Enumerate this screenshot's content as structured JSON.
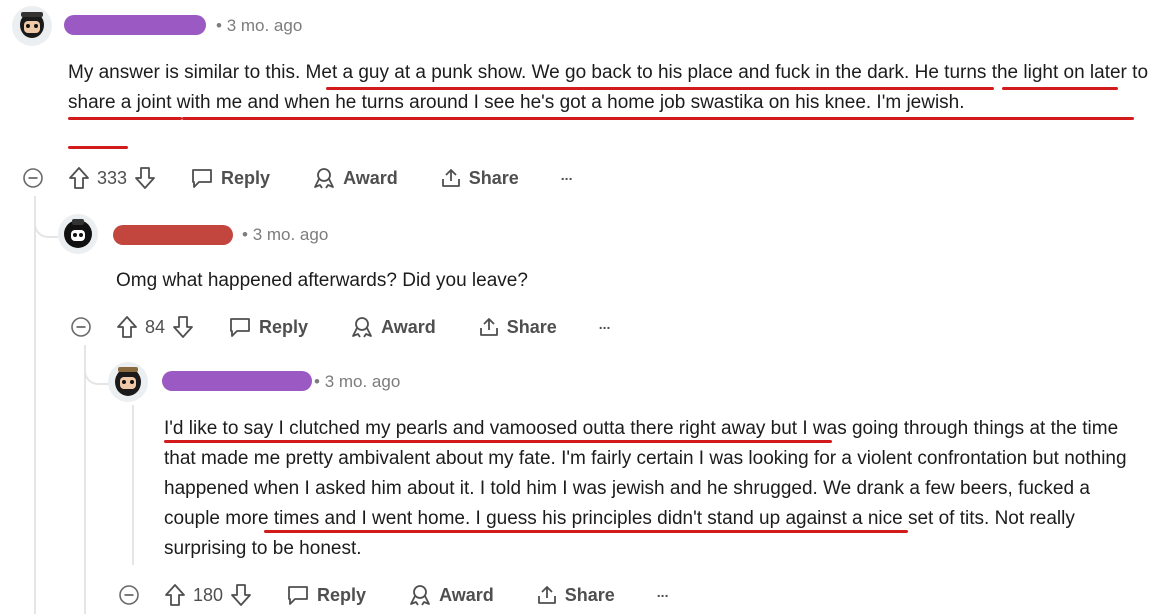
{
  "comments": [
    {
      "time": "3 mo. ago",
      "redact_color": "#9b59c4",
      "body": "My answer is similar to this. Met a guy at a punk show. We go back to his place and fuck in the dark. He turns the light on later to share a joint with me and when he turns around I see he's got a home job swastika on his knee. I'm jewish.",
      "votes": "333",
      "reply": "Reply",
      "award": "Award",
      "share": "Share",
      "more": "..."
    },
    {
      "time": "3 mo. ago",
      "redact_color": "#c2453e",
      "body": "Omg what happened afterwards? Did you leave?",
      "votes": "84",
      "reply": "Reply",
      "award": "Award",
      "share": "Share",
      "more": "..."
    },
    {
      "time": "3 mo. ago",
      "redact_color": "#9b59c4",
      "body": "I'd like to say I clutched my pearls and vamoosed outta there right away but I was going through things at the time that made me pretty ambivalent about my fate. I'm fairly certain I was looking for a violent confrontation but nothing happened when I asked him about it. I told him I was jewish and he shrugged. We drank a few beers, fucked a couple more times and I went home. I guess his principles didn't stand up against a nice set of tits. Not really surprising to be honest.",
      "votes": "180",
      "reply": "Reply",
      "award": "Award",
      "share": "Share",
      "more": "..."
    }
  ],
  "colors": {
    "underline": "#d21b1b",
    "meta": "#7c7c7c",
    "action": "#4f4f4f"
  }
}
